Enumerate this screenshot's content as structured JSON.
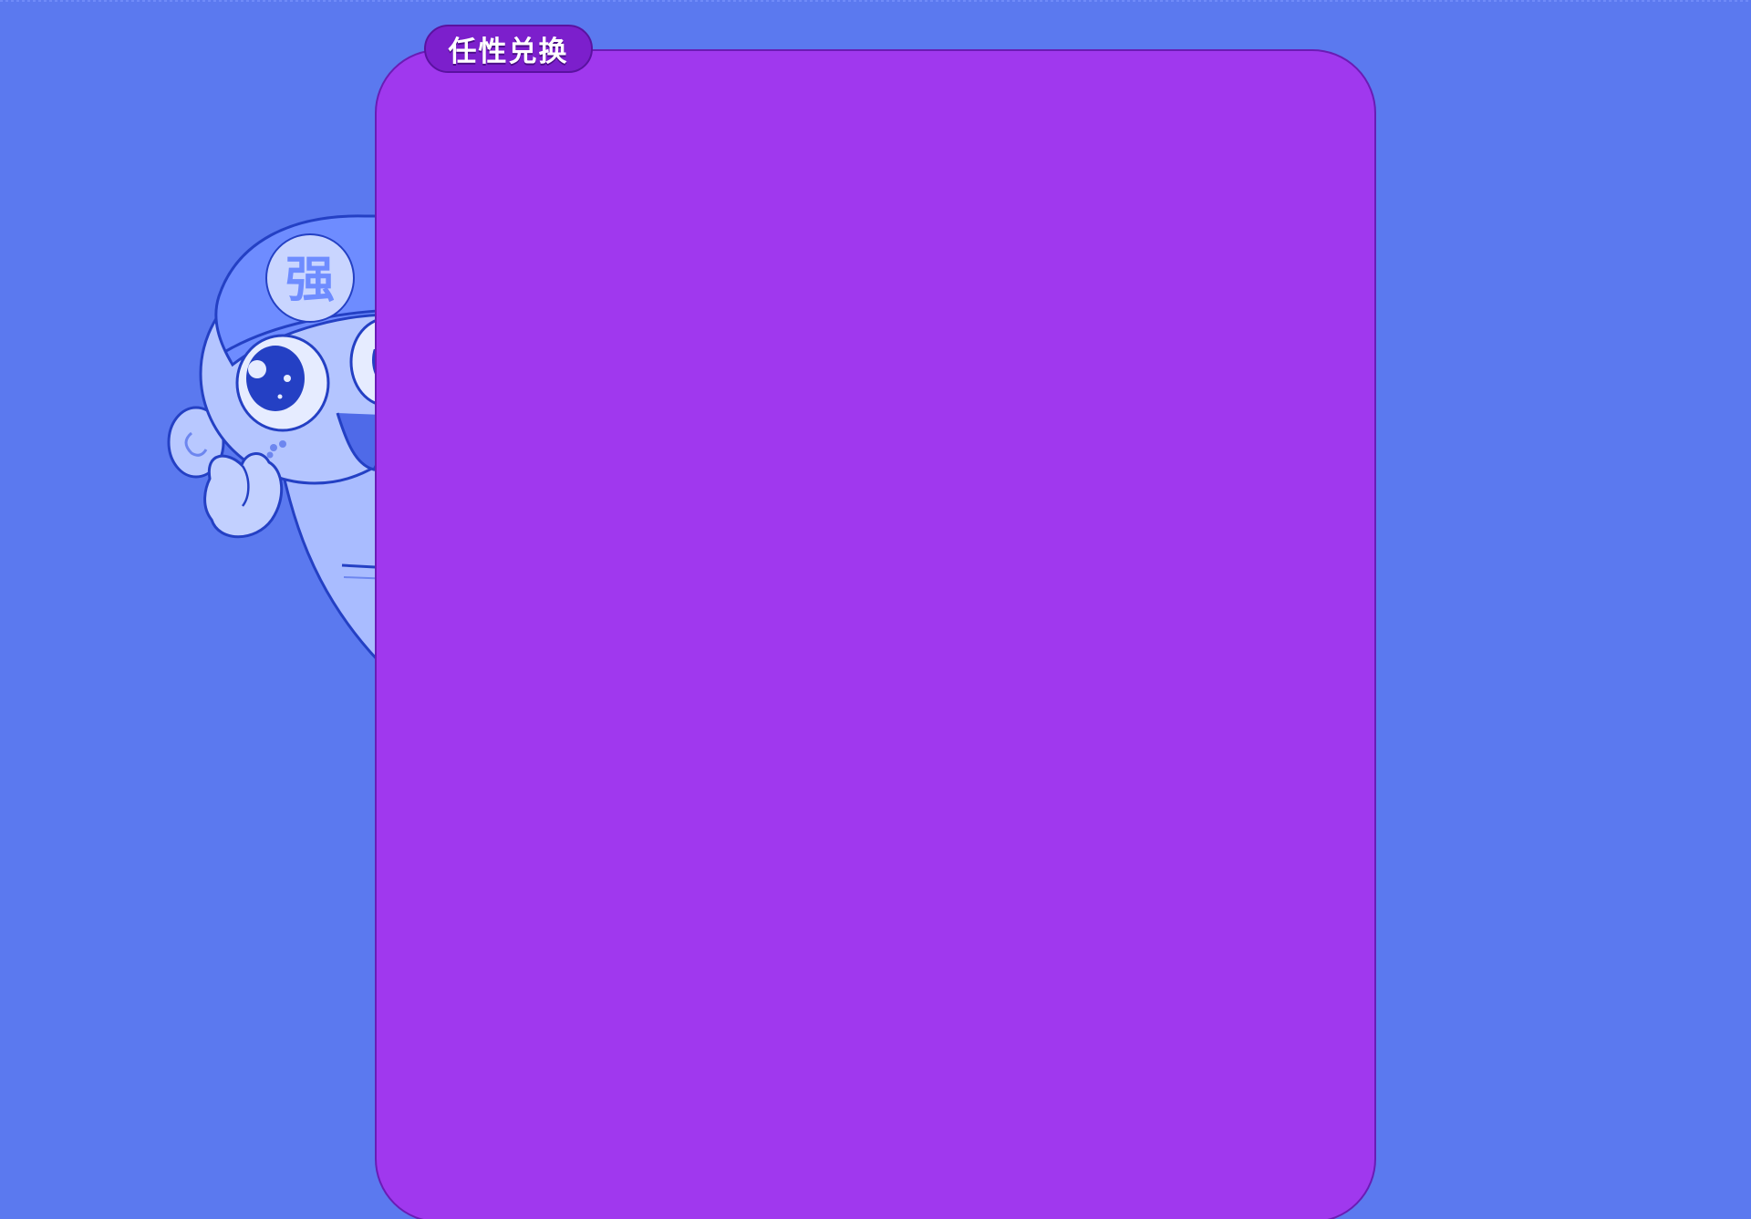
{
  "panel": {
    "tag_label": "任性兑换"
  },
  "mascot": {
    "cap_emblem": "强",
    "icon": "mascot-character"
  },
  "colors": {
    "background": "#5b79ef",
    "panel": "#a038ee",
    "panel_border": "#6a1cb5",
    "tag": "#7c1fcc",
    "mascot_outline": "#2440c4",
    "mascot_fill": "#b4c5ff"
  }
}
